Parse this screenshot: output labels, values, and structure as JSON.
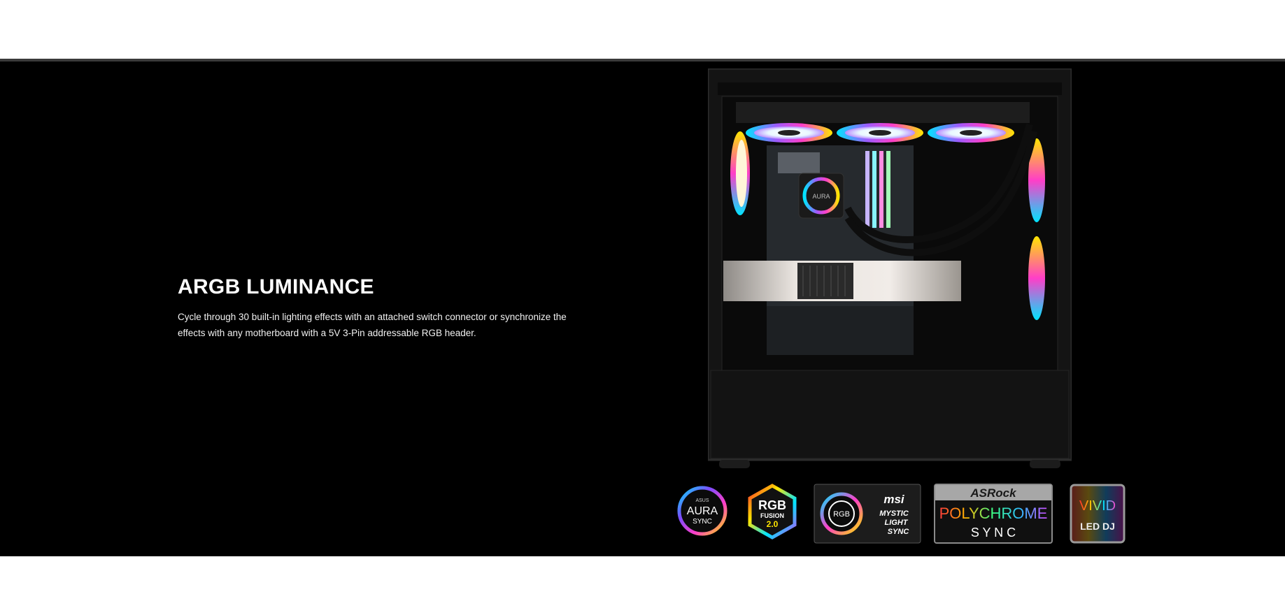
{
  "section": {
    "title": "ARGB LUMINANCE",
    "description": "Cycle through 30 built-in lighting effects with an attached switch connector or synchronize the effects with any motherboard with a 5V 3-Pin addressable RGB header."
  },
  "product_image": {
    "icon": "pc-case-image",
    "cooler_label": "AURA"
  },
  "sync_logos": {
    "asus": {
      "brand": "ASUS",
      "line1": "AURA",
      "line2": "SYNC"
    },
    "gigabyte": {
      "line1": "RGB",
      "line2": "FUSION",
      "line3": "2.0"
    },
    "msi": {
      "ring": "RGB",
      "brand": "msi",
      "line1": "MYSTIC",
      "line2": "LIGHT",
      "line3": "SYNC"
    },
    "asrock": {
      "brand": "ASRock",
      "line1": "POLYCHROME",
      "line2": "S Y N C"
    },
    "biostar": {
      "line1": "VIVID",
      "line2": "LED DJ"
    }
  },
  "colors": {
    "background": "#000000",
    "text": "#ffffff",
    "divider": "#3a3a3a"
  }
}
